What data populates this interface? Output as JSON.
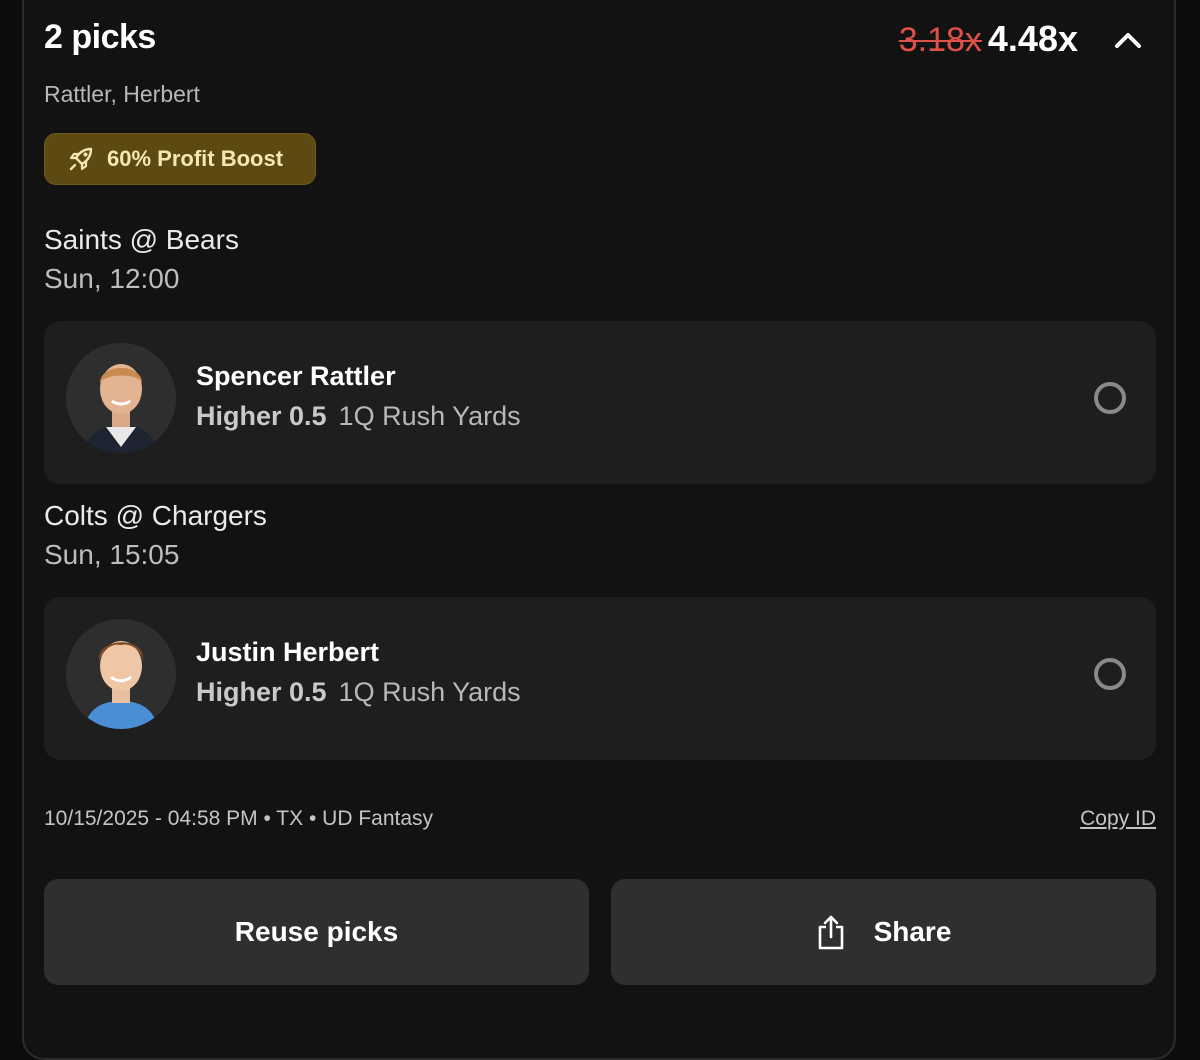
{
  "header": {
    "title": "2 picks",
    "old_multiplier": "3.18x",
    "new_multiplier": "4.48x",
    "collapse_icon": "chevron-up-icon",
    "players_summary": "Rattler, Herbert"
  },
  "boost": {
    "icon": "rocket-icon",
    "label": "60% Profit Boost"
  },
  "games": [
    {
      "matchup": "Saints @ Bears",
      "time": "Sun, 12:00",
      "pick": {
        "player": "Spencer Rattler",
        "direction": "Higher 0.5",
        "stat": "1Q Rush Yards"
      }
    },
    {
      "matchup": "Colts @ Chargers",
      "time": "Sun, 15:05",
      "pick": {
        "player": "Justin Herbert",
        "direction": "Higher 0.5",
        "stat": "1Q Rush Yards"
      }
    }
  ],
  "footer": {
    "meta": "10/15/2025 - 04:58 PM • TX • UD Fantasy",
    "copy_id_label": "Copy ID"
  },
  "actions": {
    "reuse_label": "Reuse picks",
    "share_label": "Share",
    "share_icon": "share-icon"
  },
  "colors": {
    "background": "#0c0c0c",
    "card": "#121212",
    "pick_card": "#1e1e1e",
    "boost_bg": "#5c4a12",
    "boost_text": "#f6e7b0",
    "old_multiplier": "#e0504a",
    "button": "#2f2f2f"
  }
}
